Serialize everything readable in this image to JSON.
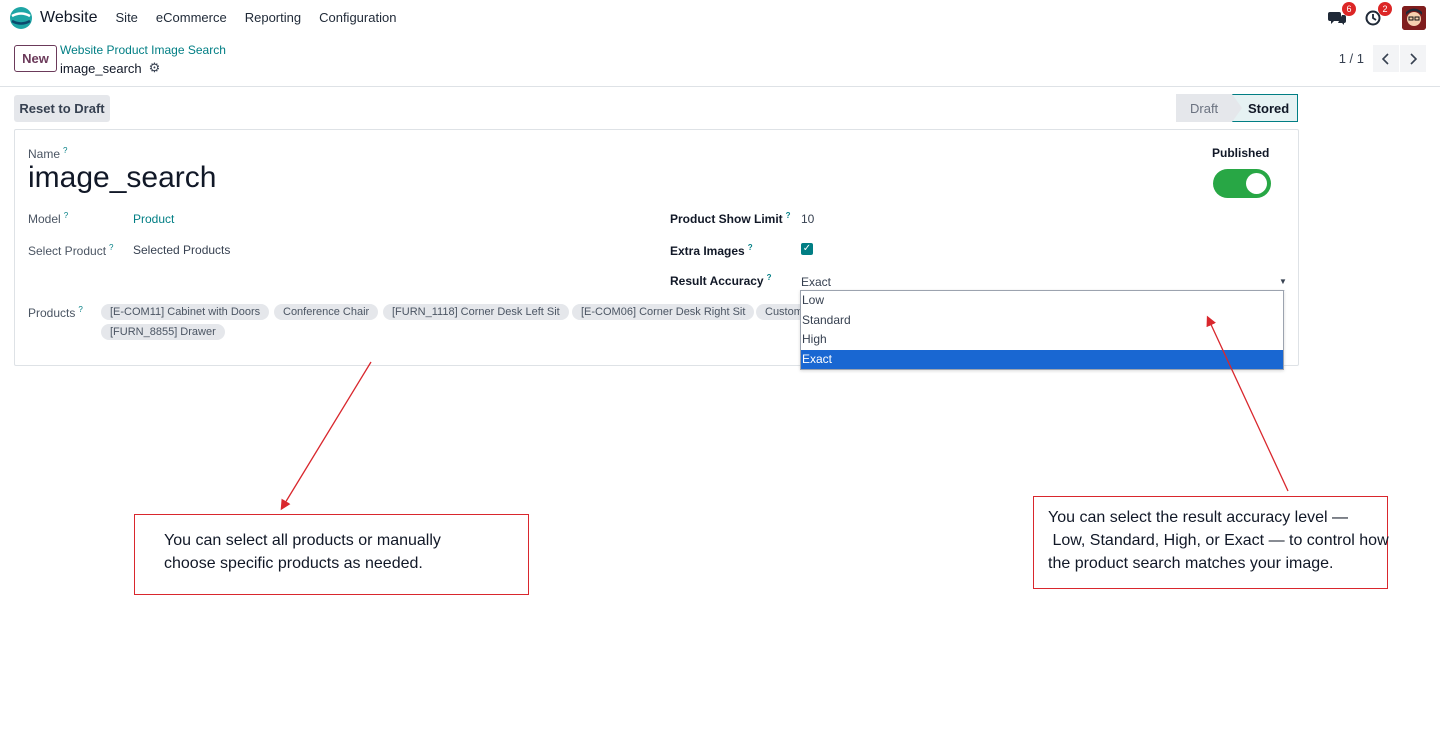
{
  "navbar": {
    "app_name": "Website",
    "menu": [
      "Site",
      "eCommerce",
      "Reporting",
      "Configuration"
    ],
    "messages_badge": "6",
    "activities_badge": "2"
  },
  "control_panel": {
    "new_label": "New",
    "breadcrumb_parent": "Website Product Image Search",
    "breadcrumb_current": "image_search",
    "pager": "1 / 1"
  },
  "header": {
    "reset_label": "Reset to Draft",
    "stages": [
      "Draft",
      "Stored"
    ],
    "active_stage": "Stored"
  },
  "form": {
    "name_label": "Name",
    "name_value": "image_search",
    "published_label": "Published",
    "published": true,
    "model_label": "Model",
    "model_value": "Product",
    "select_product_label": "Select Product",
    "select_product_value": "Selected Products",
    "show_limit_label": "Product Show Limit",
    "show_limit_value": "10",
    "extra_images_label": "Extra Images",
    "extra_images": true,
    "accuracy_label": "Result Accuracy",
    "accuracy_value": "Exact",
    "products_label": "Products",
    "products": [
      "[E-COM11] Cabinet with Doors",
      "Conference Chair",
      "[FURN_1118] Corner Desk Left Sit",
      "[E-COM06] Corner Desk Right Sit",
      "Customizable Desk",
      "[FURN_8855] Drawer"
    ]
  },
  "accuracy_dropdown": {
    "options": [
      "Low",
      "Standard",
      "High",
      "Exact"
    ],
    "selected": "Exact"
  },
  "annotations": {
    "products_note_line1": "You can select all products or manually",
    "products_note_line2": "choose specific products as needed.",
    "accuracy_note_line1": "You can select the result accuracy level —",
    "accuracy_note_line2": " Low, Standard, High, or Exact — to control how",
    "accuracy_note_line3": "the product search matches your image.",
    "arrow_color": "#d9272d"
  },
  "colors": {
    "accent": "#017e84",
    "brand": "#6b3a5a",
    "toggle_on": "#28a745",
    "selection": "#1967d2"
  }
}
